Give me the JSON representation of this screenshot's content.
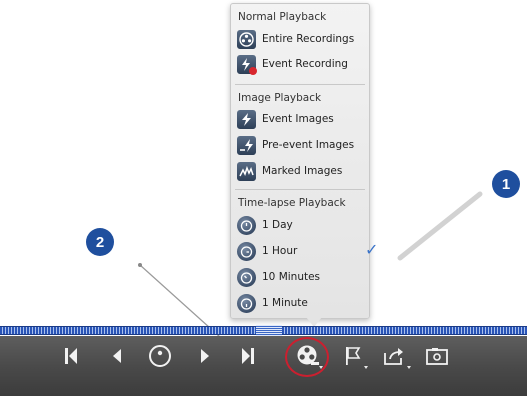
{
  "menu": {
    "sections": [
      {
        "title": "Normal Playback",
        "items": [
          {
            "label": "Entire Recordings",
            "icon": "film-reel-icon"
          },
          {
            "label": "Event Recording",
            "icon": "lightning-record-icon"
          }
        ]
      },
      {
        "title": "Image Playback",
        "items": [
          {
            "label": "Event Images",
            "icon": "lightning-icon"
          },
          {
            "label": "Pre-event Images",
            "icon": "pre-event-icon"
          },
          {
            "label": "Marked Images",
            "icon": "marked-images-icon"
          }
        ]
      },
      {
        "title": "Time-lapse Playback",
        "items": [
          {
            "label": "1 Day",
            "icon": "stopwatch-icon"
          },
          {
            "label": "1 Hour",
            "icon": "stopwatch-icon",
            "selected": true
          },
          {
            "label": "10 Minutes",
            "icon": "stopwatch-icon"
          },
          {
            "label": "1 Minute",
            "icon": "stopwatch-icon"
          }
        ]
      }
    ]
  },
  "callouts": {
    "one": "1",
    "two": "2"
  },
  "toolbar": {
    "buttons": [
      "skip-to-start-icon",
      "step-back-icon",
      "pause-play-icon",
      "step-forward-icon",
      "skip-to-end-icon",
      "playback-mode-icon",
      "flag-icon",
      "export-icon",
      "snapshot-icon"
    ]
  },
  "colors": {
    "accent": "#1f4f9e",
    "highlight": "#cc1f2f",
    "checkmark": "#3b74c9",
    "record_dot": "#d8262d"
  }
}
